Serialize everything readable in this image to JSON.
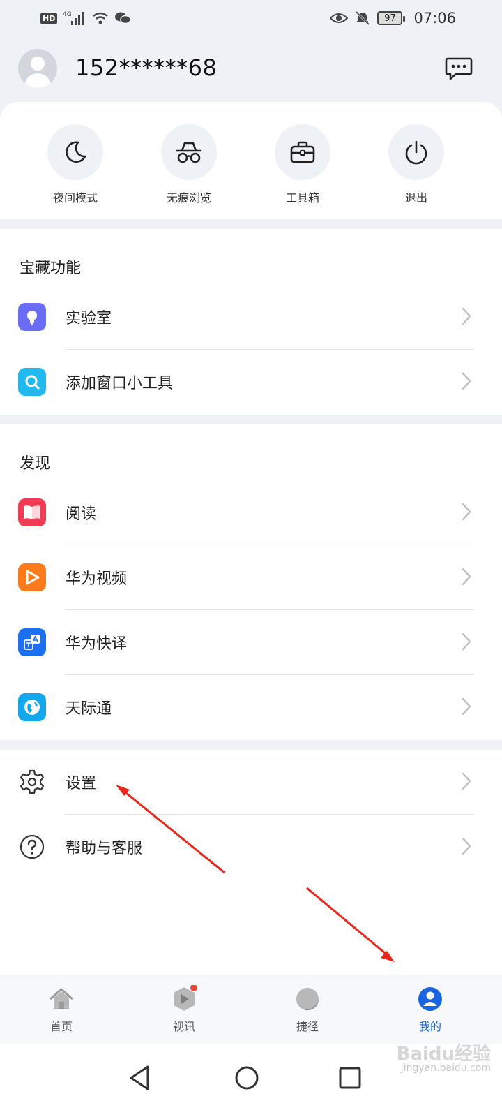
{
  "status_bar": {
    "network": "4G",
    "hd": "HD",
    "battery": "97",
    "time": "07:06"
  },
  "profile": {
    "phone": "152******68"
  },
  "quick_actions": [
    {
      "label": "夜间模式",
      "icon": "moon-icon"
    },
    {
      "label": "无痕浏览",
      "icon": "incognito-icon"
    },
    {
      "label": "工具箱",
      "icon": "toolbox-icon"
    },
    {
      "label": "退出",
      "icon": "power-icon"
    }
  ],
  "treasure": {
    "title": "宝藏功能",
    "items": [
      {
        "label": "实验室",
        "icon": "lightbulb-icon",
        "color": "#6b6cf5"
      },
      {
        "label": "添加窗口小工具",
        "icon": "search-widget-icon",
        "color": "#22b8f0"
      }
    ]
  },
  "discover": {
    "title": "发现",
    "items": [
      {
        "label": "阅读",
        "icon": "book-icon",
        "color": "#f03d55"
      },
      {
        "label": "华为视频",
        "icon": "play-icon",
        "color": "#ff7a1a"
      },
      {
        "label": "华为快译",
        "icon": "translate-icon",
        "color": "#1d6ff2"
      },
      {
        "label": "天际通",
        "icon": "globe-icon",
        "color": "#13a8ec"
      }
    ]
  },
  "misc": {
    "items": [
      {
        "label": "设置",
        "icon": "gear-icon"
      },
      {
        "label": "帮助与客服",
        "icon": "help-icon"
      }
    ]
  },
  "bottom_nav": [
    {
      "label": "首页",
      "icon": "home-icon"
    },
    {
      "label": "视讯",
      "icon": "video-icon"
    },
    {
      "label": "捷径",
      "icon": "shortcut-icon"
    },
    {
      "label": "我的",
      "icon": "user-icon",
      "active": true
    }
  ],
  "watermark": {
    "brand": "Baidu经验",
    "url": "jingyan.baidu.com"
  }
}
